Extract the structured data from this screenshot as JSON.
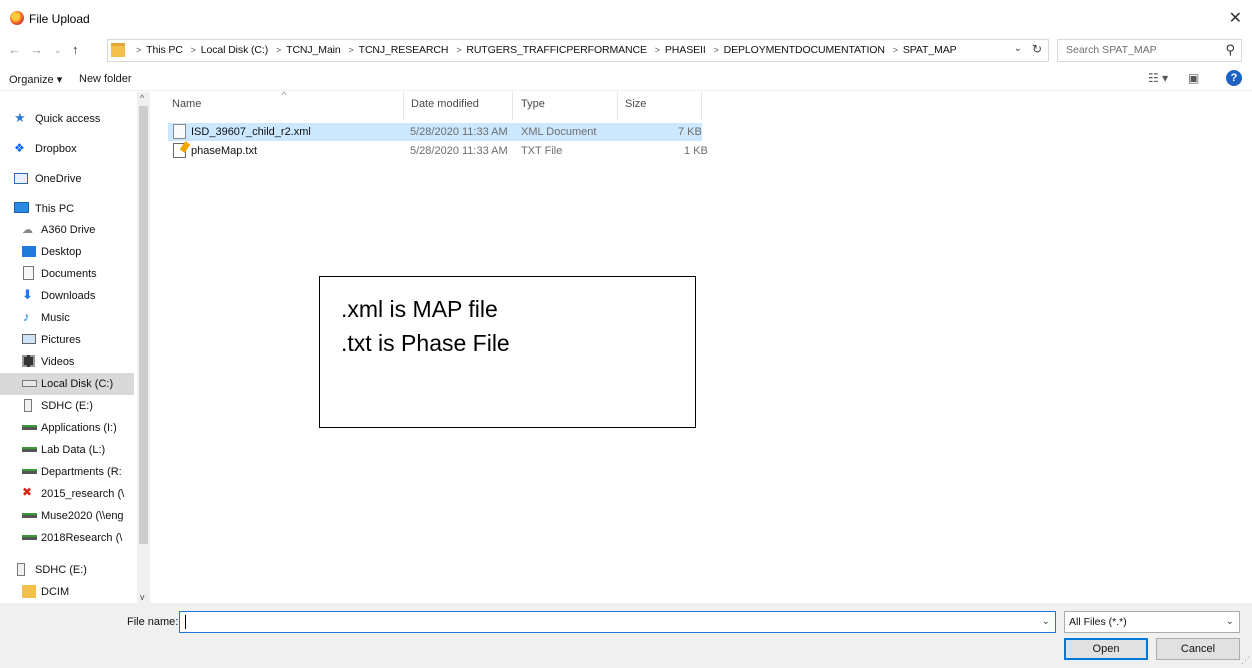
{
  "window": {
    "title": "File Upload",
    "close_symbol": "✕"
  },
  "address": {
    "crumbs": [
      "This PC",
      "Local Disk (C:)",
      "TCNJ_Main",
      "TCNJ_RESEARCH",
      "RUTGERS_TRAFFICPERFORMANCE",
      "PHASEII",
      "DEPLOYMENTDOCUMENTATION",
      "SPAT_MAP"
    ],
    "search_placeholder": "Search SPAT_MAP"
  },
  "toolbar": {
    "organize_label": "Organize ▾",
    "new_folder_label": "New folder"
  },
  "nav": {
    "items": [
      {
        "label": "Quick access",
        "icon": "star-icon"
      },
      {
        "label": "Dropbox",
        "icon": "dropbox-icon"
      },
      {
        "label": "OneDrive",
        "icon": "onedrive-icon"
      },
      {
        "label": "This PC",
        "icon": "monitor-icon"
      },
      {
        "label": "A360 Drive",
        "icon": "cloud-drive-icon"
      },
      {
        "label": "Desktop",
        "icon": "desktop-icon"
      },
      {
        "label": "Documents",
        "icon": "documents-icon"
      },
      {
        "label": "Downloads",
        "icon": "download-arrow-icon"
      },
      {
        "label": "Music",
        "icon": "music-note-icon"
      },
      {
        "label": "Pictures",
        "icon": "pictures-icon"
      },
      {
        "label": "Videos",
        "icon": "videos-icon"
      },
      {
        "label": "Local Disk (C:)",
        "icon": "drive-icon"
      },
      {
        "label": "SDHC (E:)",
        "icon": "sd-card-icon"
      },
      {
        "label": "Applications (I:)",
        "icon": "network-drive-icon"
      },
      {
        "label": "Lab Data (L:)",
        "icon": "network-drive-icon"
      },
      {
        "label": "Departments (R:",
        "icon": "network-drive-icon"
      },
      {
        "label": "2015_research (\\",
        "icon": "disconnected-drive-icon"
      },
      {
        "label": "Muse2020 (\\\\eng",
        "icon": "network-drive-icon"
      },
      {
        "label": "2018Research (\\",
        "icon": "network-drive-icon"
      },
      {
        "label": "SDHC (E:)",
        "icon": "sd-card-icon"
      },
      {
        "label": "DCIM",
        "icon": "folder-icon"
      }
    ],
    "selected": "Local Disk (C:)"
  },
  "files": {
    "columns": {
      "name": "Name",
      "date": "Date modified",
      "type": "Type",
      "size": "Size"
    },
    "rows": [
      {
        "name": "ISD_39607_child_r2.xml",
        "date": "5/28/2020 11:33 AM",
        "type": "XML Document",
        "size": "7 KB",
        "icon": "xml-file-icon",
        "selected": true
      },
      {
        "name": "phaseMap.txt",
        "date": "5/28/2020 11:33 AM",
        "type": "TXT File",
        "size": "1 KB",
        "icon": "text-file-icon",
        "selected": false
      }
    ]
  },
  "callout": {
    "line1": ".xml is MAP file",
    "line2": ".txt is Phase File"
  },
  "bottom": {
    "file_name_label": "File name:",
    "file_name_value": "",
    "file_type_value": "All Files (*.*)",
    "open_label": "Open",
    "cancel_label": "Cancel"
  },
  "colors": {
    "selection": "#cce8ff",
    "accent": "#0078d7",
    "nav_selected": "#d9d9d9"
  }
}
